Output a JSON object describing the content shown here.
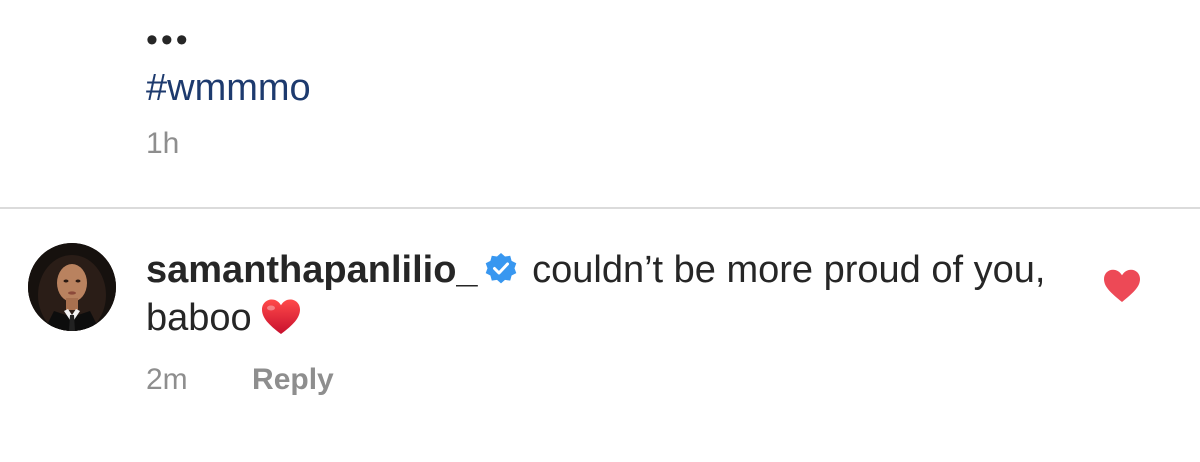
{
  "caption": {
    "more_label": "•••",
    "hashtag": "#wmmmo",
    "time": "1h"
  },
  "comment": {
    "avatar_icon": "profile-photo",
    "username": "samanthapanlilio_",
    "verified_icon": "verified-badge-icon",
    "text": "couldn’t be more proud of you, baboo",
    "emoji": "red-heart-emoji",
    "time": "2m",
    "reply_label": "Reply",
    "like_icon": "heart-icon",
    "liked": true
  },
  "colors": {
    "hashtag": "#1d3a6e",
    "secondary_text": "#8e8e8e",
    "verified_blue": "#3897f0",
    "like_red": "#ed4956",
    "divider": "#dbdbdb"
  }
}
